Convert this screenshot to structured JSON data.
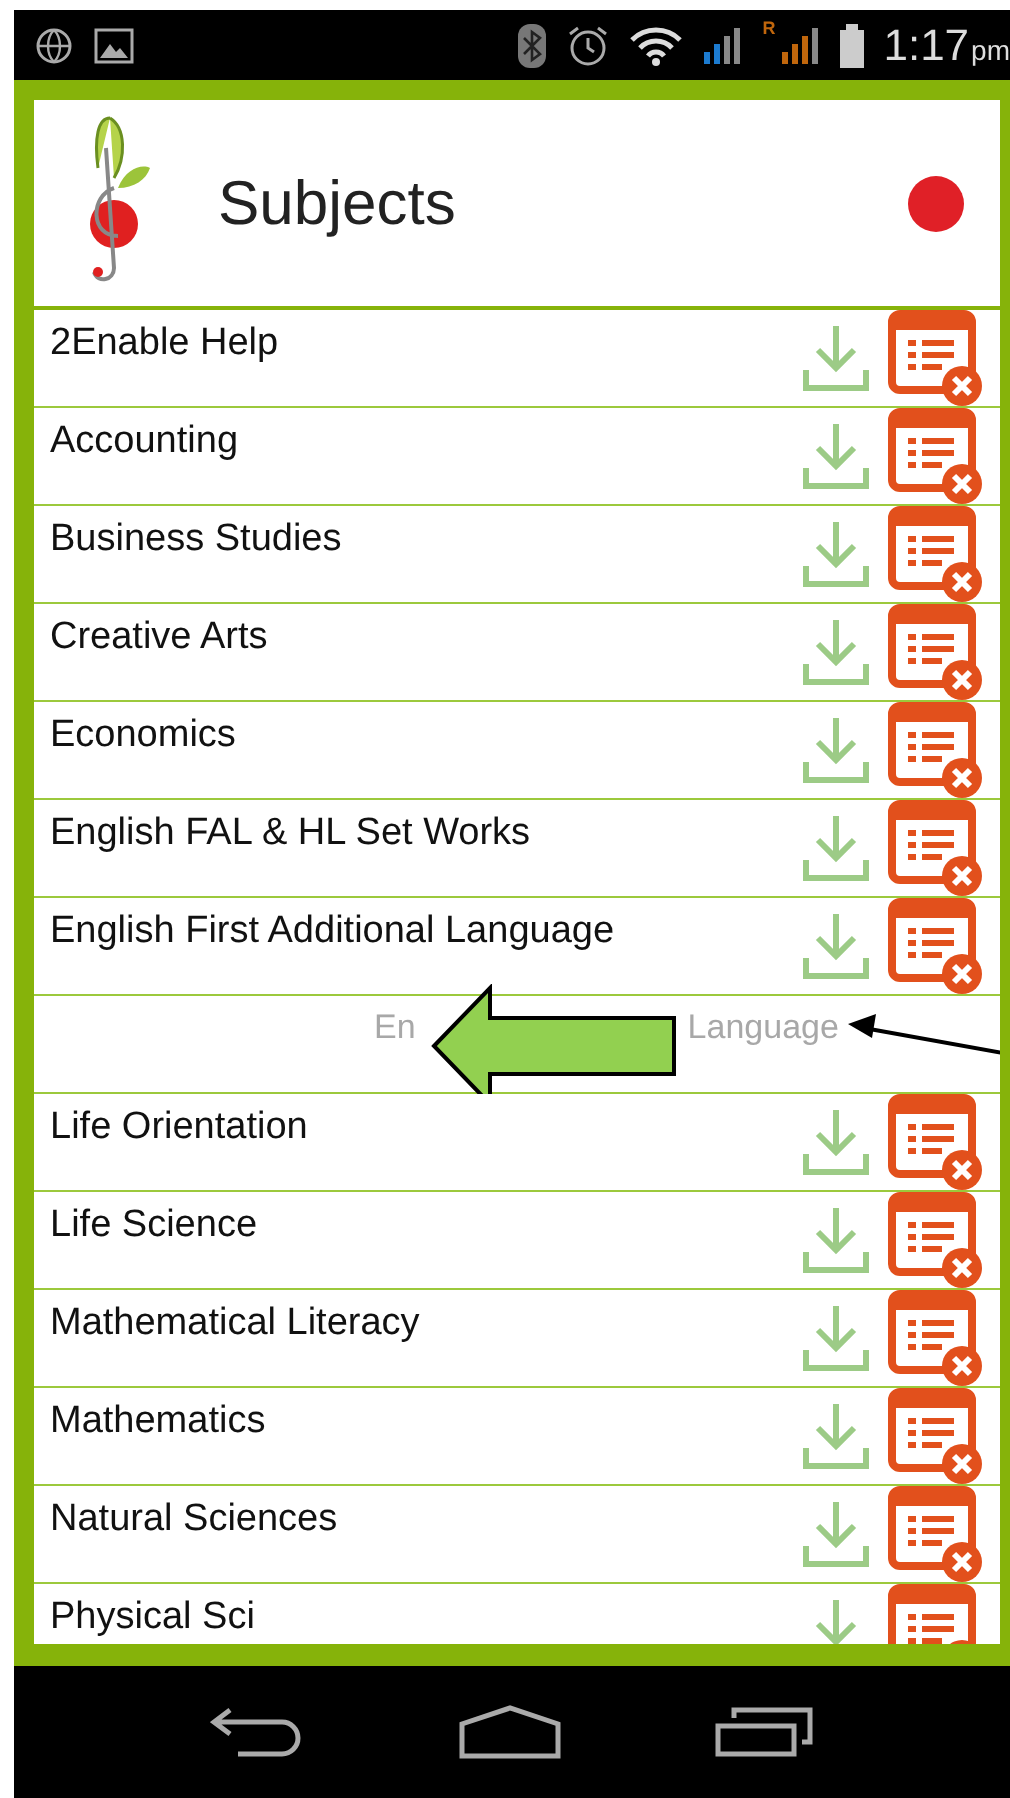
{
  "status_bar": {
    "time": "1:17",
    "ampm": "pm",
    "roaming": "R"
  },
  "header": {
    "title": "Subjects",
    "record_on": true
  },
  "rows": [
    {
      "kind": "subject",
      "label": "2Enable Help"
    },
    {
      "kind": "subject",
      "label": "Accounting"
    },
    {
      "kind": "subject",
      "label": "Business Studies"
    },
    {
      "kind": "subject",
      "label": "Creative Arts"
    },
    {
      "kind": "subject",
      "label": "Economics"
    },
    {
      "kind": "subject",
      "label": "English FAL & HL Set Works"
    },
    {
      "kind": "subject",
      "label": "English First Additional Language"
    },
    {
      "kind": "ghost",
      "parts": [
        "En",
        "Language"
      ]
    },
    {
      "kind": "subject",
      "label": "Life Orientation"
    },
    {
      "kind": "subject",
      "label": "Life Science"
    },
    {
      "kind": "subject",
      "label": "Mathematical Literacy"
    },
    {
      "kind": "subject",
      "label": "Mathematics"
    },
    {
      "kind": "subject",
      "label": "Natural Sciences"
    },
    {
      "kind": "subject",
      "label": "Physical Sci"
    }
  ]
}
